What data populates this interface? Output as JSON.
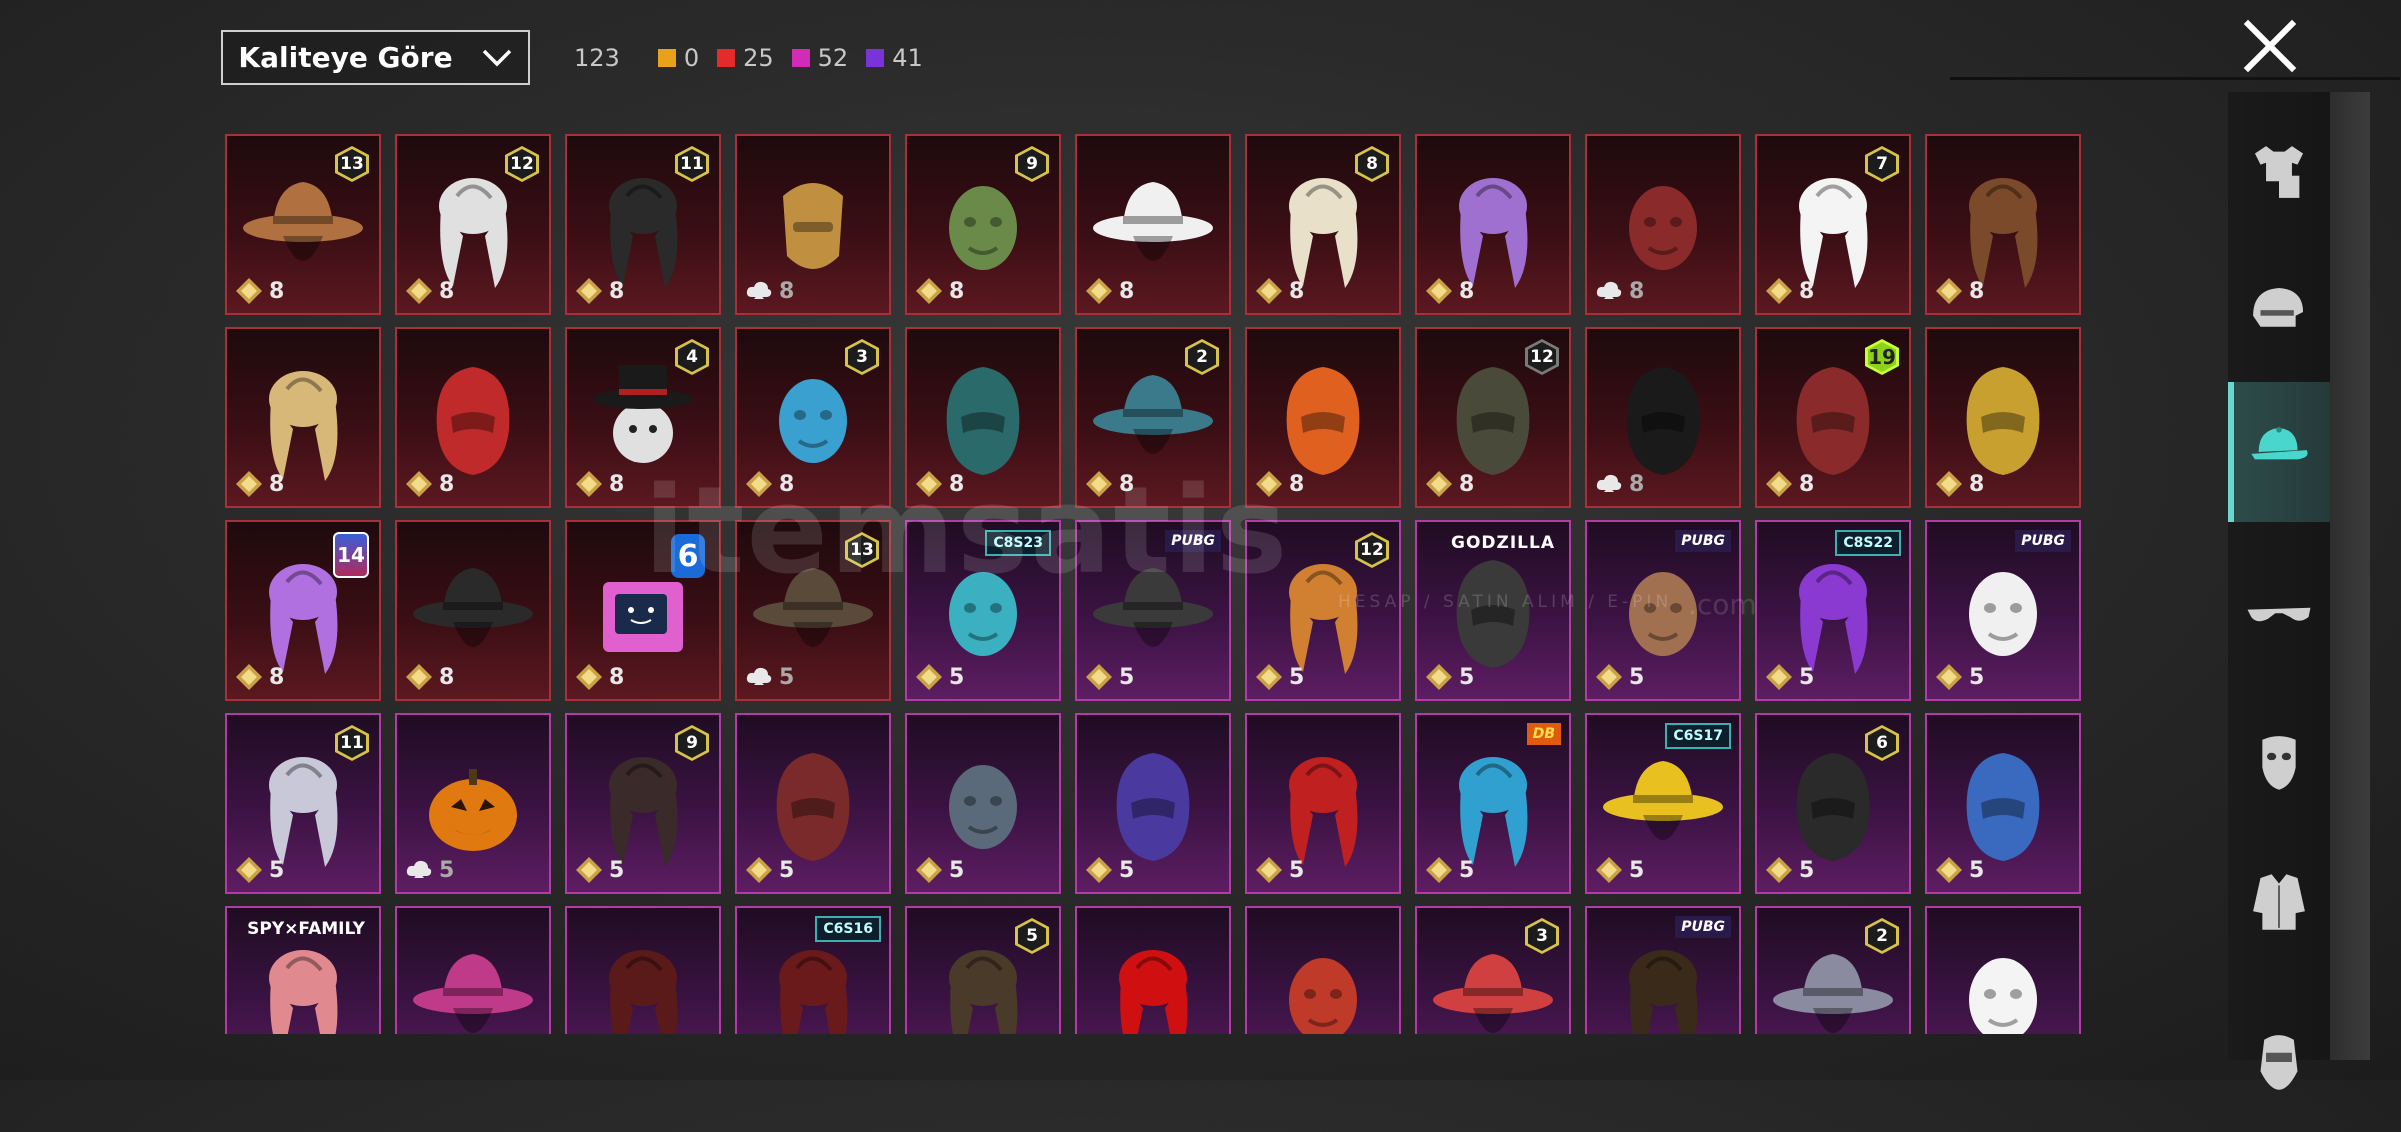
{
  "sort_dropdown": {
    "label": "Kaliteye Göre"
  },
  "counts": {
    "total": "123",
    "tiers": [
      {
        "label": "0",
        "color": "#e8a21a"
      },
      {
        "label": "25",
        "color": "#e42b2b"
      },
      {
        "label": "52",
        "color": "#d12bb8"
      },
      {
        "label": "41",
        "color": "#7a33d8"
      }
    ]
  },
  "watermark": {
    "text": "itemsatis",
    "sub": "HESAP / SATIN ALIM / E-PIN",
    "domain": ".com"
  },
  "categories": [
    "outfit-icon",
    "helmet-icon",
    "hat-icon",
    "glasses-icon",
    "mask-icon",
    "jacket-icon",
    "face-icon"
  ],
  "active_category": 2,
  "rows": [
    {
      "tier": "red",
      "items": [
        {
          "art": "hat",
          "color": "#b07040",
          "badge_kind": "lvl",
          "badge": "13",
          "cur": "gold",
          "price": "8"
        },
        {
          "art": "hair",
          "color": "#e0e0e0",
          "badge_kind": "lvl",
          "badge": "12",
          "cur": "gold",
          "price": "8"
        },
        {
          "art": "hair",
          "color": "#2a2a2a",
          "badge_kind": "lvl",
          "badge": "11",
          "cur": "gold",
          "price": "8"
        },
        {
          "art": "mask",
          "color": "#c09040",
          "badge_kind": "",
          "badge": "",
          "cur": "cloud",
          "price": "8"
        },
        {
          "art": "head",
          "color": "#6a8a4a",
          "badge_kind": "lvl",
          "badge": "9",
          "cur": "gold",
          "price": "8"
        },
        {
          "art": "hat",
          "color": "#f0f0f0",
          "badge_kind": "",
          "badge": "",
          "cur": "gold",
          "price": "8"
        },
        {
          "art": "hair",
          "color": "#e8e0c8",
          "badge_kind": "lvl",
          "badge": "8",
          "cur": "gold",
          "price": "8"
        },
        {
          "art": "hair",
          "color": "#a070d0",
          "badge_kind": "",
          "badge": "",
          "cur": "gold",
          "price": "8"
        },
        {
          "art": "head",
          "color": "#8a2a2a",
          "badge_kind": "",
          "badge": "",
          "cur": "cloud",
          "price": "8"
        },
        {
          "art": "hair",
          "color": "#f4f4f4",
          "badge_kind": "lvl",
          "badge": "7",
          "cur": "gold",
          "price": "8"
        },
        {
          "art": "hair",
          "color": "#7a4a2a",
          "badge_kind": "",
          "badge": "",
          "cur": "gold",
          "price": "8"
        }
      ]
    },
    {
      "tier": "red",
      "items": [
        {
          "art": "hair",
          "color": "#d8b878",
          "badge_kind": "",
          "badge": "",
          "cur": "gold",
          "price": "8"
        },
        {
          "art": "helmet",
          "color": "#c02a2a",
          "badge_kind": "",
          "badge": "",
          "cur": "gold",
          "price": "8"
        },
        {
          "art": "snow",
          "color": "#e0e0e0",
          "badge_kind": "lvl",
          "badge": "4",
          "cur": "gold",
          "price": "8"
        },
        {
          "art": "head",
          "color": "#3aa0d0",
          "badge_kind": "lvl",
          "badge": "3",
          "cur": "gold",
          "price": "8"
        },
        {
          "art": "helmet",
          "color": "#2a6a6a",
          "badge_kind": "",
          "badge": "",
          "cur": "gold",
          "price": "8"
        },
        {
          "art": "hat",
          "color": "#3a7a8a",
          "badge_kind": "lvl",
          "badge": "2",
          "cur": "gold",
          "price": "8"
        },
        {
          "art": "helmet",
          "color": "#e06020",
          "badge_kind": "",
          "badge": "",
          "cur": "gold",
          "price": "8"
        },
        {
          "art": "helmet",
          "color": "#4a4a3a",
          "badge_kind": "s12g",
          "badge": "12",
          "cur": "gold",
          "price": "8"
        },
        {
          "art": "helmet",
          "color": "#1a1a1a",
          "badge_kind": "",
          "badge": "",
          "cur": "cloud",
          "price": "8"
        },
        {
          "art": "helmet",
          "color": "#8a2a2a",
          "badge_kind": "s19",
          "badge": "19",
          "cur": "gold",
          "price": "8"
        },
        {
          "art": "helmet",
          "color": "#c8a030",
          "badge_kind": "",
          "badge": "",
          "cur": "gold",
          "price": "8"
        }
      ]
    },
    {
      "tier": "mixed",
      "items": [
        {
          "tier": "red",
          "art": "hair",
          "color": "#b070e0",
          "badge_kind": "s14",
          "badge": "14",
          "cur": "gold",
          "price": "8"
        },
        {
          "tier": "red",
          "art": "hat",
          "color": "#2a2a2a",
          "badge_kind": "",
          "badge": "",
          "cur": "gold",
          "price": "8"
        },
        {
          "tier": "red",
          "art": "box",
          "color": "#e060d0",
          "badge_kind": "six",
          "badge": "6",
          "cur": "gold",
          "price": "8"
        },
        {
          "tier": "red",
          "art": "hat",
          "color": "#5a4a3a",
          "badge_kind": "lvl",
          "badge": "13",
          "cur": "cloud",
          "price": "5"
        },
        {
          "tier": "pink",
          "art": "head",
          "color": "#3ab0c0",
          "badge_kind": "cbs",
          "badge": "C8S23",
          "cur": "gold",
          "price": "5"
        },
        {
          "tier": "pink",
          "art": "hat",
          "color": "#3a3a3a",
          "badge_kind": "pubg",
          "badge": "PUBG",
          "cur": "gold",
          "price": "5"
        },
        {
          "tier": "pink",
          "art": "hair",
          "color": "#d08030",
          "badge_kind": "lvl",
          "badge": "12",
          "cur": "gold",
          "price": "5"
        },
        {
          "tier": "pink",
          "art": "helmet",
          "color": "#3a3a3a",
          "badge_kind": "god",
          "badge": "GODZILLA",
          "cur": "gold",
          "price": "5"
        },
        {
          "tier": "pink",
          "art": "head",
          "color": "#a07050",
          "badge_kind": "pubg",
          "badge": "PUBG",
          "cur": "gold",
          "price": "5"
        },
        {
          "tier": "pink",
          "art": "hair",
          "color": "#8a3ad0",
          "badge_kind": "cbs",
          "badge": "C8S22",
          "cur": "gold",
          "price": "5"
        },
        {
          "tier": "pink",
          "art": "head",
          "color": "#f0f0f0",
          "badge_kind": "pubg",
          "badge": "PUBG",
          "cur": "gold",
          "price": "5"
        }
      ]
    },
    {
      "tier": "pink",
      "items": [
        {
          "art": "hair",
          "color": "#c8c8d8",
          "badge_kind": "lvl",
          "badge": "11",
          "cur": "gold",
          "price": "5"
        },
        {
          "art": "pumpkin",
          "color": "#e07a10",
          "badge_kind": "",
          "badge": "",
          "cur": "cloud",
          "price": "5"
        },
        {
          "art": "hair",
          "color": "#3a2a2a",
          "badge_kind": "lvl",
          "badge": "9",
          "cur": "gold",
          "price": "5"
        },
        {
          "art": "helmet",
          "color": "#7a2a2a",
          "badge_kind": "",
          "badge": "",
          "cur": "gold",
          "price": "5"
        },
        {
          "art": "head",
          "color": "#5a6a7a",
          "badge_kind": "",
          "badge": "",
          "cur": "gold",
          "price": "5"
        },
        {
          "art": "helmet",
          "color": "#4a3aa0",
          "badge_kind": "",
          "badge": "",
          "cur": "gold",
          "price": "5"
        },
        {
          "art": "hair",
          "color": "#c02020",
          "badge_kind": "",
          "badge": "",
          "cur": "gold",
          "price": "5"
        },
        {
          "art": "hair",
          "color": "#30a0d0",
          "badge_kind": "db",
          "badge": "DB",
          "cur": "gold",
          "price": "5"
        },
        {
          "art": "hat",
          "color": "#e8c020",
          "badge_kind": "cbs",
          "badge": "C6S17",
          "cur": "gold",
          "price": "5"
        },
        {
          "art": "helmet",
          "color": "#2a2a2a",
          "badge_kind": "lvl",
          "badge": "6",
          "cur": "gold",
          "price": "5"
        },
        {
          "art": "helmet",
          "color": "#3a6ac0",
          "badge_kind": "",
          "badge": "",
          "cur": "gold",
          "price": "5"
        }
      ]
    },
    {
      "tier": "pink",
      "items": [
        {
          "art": "hair",
          "color": "#e08a90",
          "badge_kind": "spy",
          "badge": "SPY×FAMILY",
          "cur": "",
          "price": ""
        },
        {
          "art": "hat",
          "color": "#c03a8a",
          "badge_kind": "",
          "badge": "",
          "cur": "",
          "price": ""
        },
        {
          "art": "hair",
          "color": "#5a1a1a",
          "badge_kind": "",
          "badge": "",
          "cur": "",
          "price": ""
        },
        {
          "art": "hair",
          "color": "#6a1a1a",
          "badge_kind": "cbs",
          "badge": "C6S16",
          "cur": "",
          "price": ""
        },
        {
          "art": "hair",
          "color": "#4a3a2a",
          "badge_kind": "lvl",
          "badge": "5",
          "cur": "",
          "price": ""
        },
        {
          "art": "hair",
          "color": "#d01010",
          "badge_kind": "",
          "badge": "",
          "cur": "",
          "price": ""
        },
        {
          "art": "head",
          "color": "#c03a2a",
          "badge_kind": "",
          "badge": "",
          "cur": "",
          "price": ""
        },
        {
          "art": "hat",
          "color": "#d04040",
          "badge_kind": "lvl",
          "badge": "3",
          "cur": "",
          "price": ""
        },
        {
          "art": "hair",
          "color": "#3a2a1a",
          "badge_kind": "pubg",
          "badge": "PUBG",
          "cur": "",
          "price": ""
        },
        {
          "art": "hat",
          "color": "#8a8aa0",
          "badge_kind": "lvl",
          "badge": "2",
          "cur": "",
          "price": ""
        },
        {
          "art": "head",
          "color": "#f4f4f4",
          "badge_kind": "",
          "badge": "",
          "cur": "",
          "price": ""
        }
      ]
    }
  ]
}
